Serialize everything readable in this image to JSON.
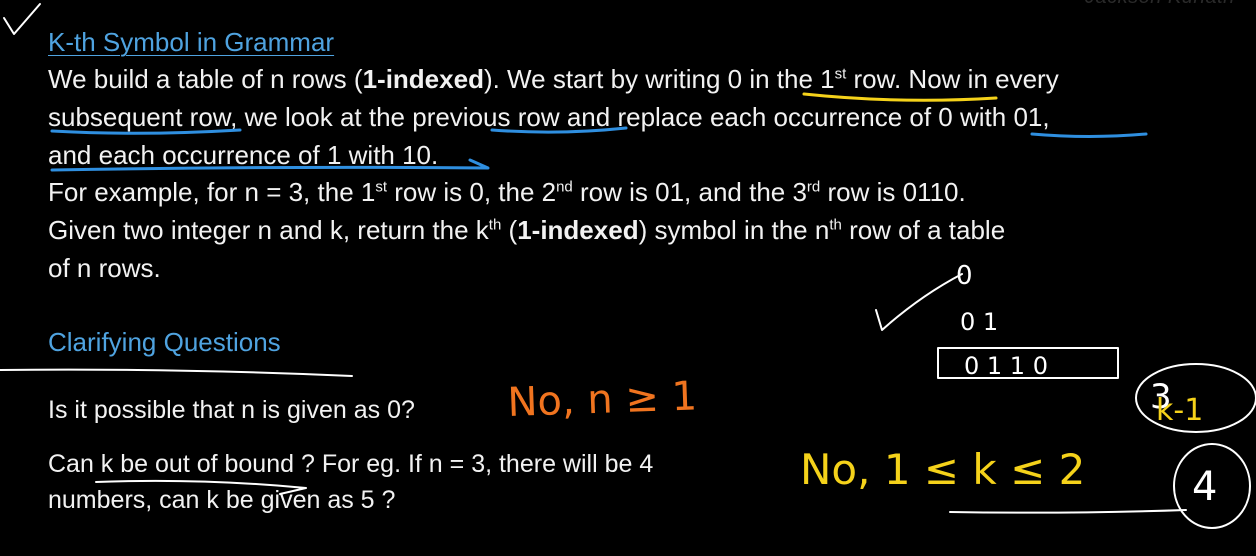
{
  "watermark": "Jackson Kuriath",
  "problem": {
    "title": "K-th Symbol in Grammar",
    "line1_a": "We build a table of n rows (",
    "line1_bold": "1-indexed",
    "line1_b": "). We start by writing 0 in the 1",
    "line1_sup": "st",
    "line1_c": " row. Now in every",
    "line2": "subsequent row, we look at the previous row and replace each occurrence of 0 with 01,",
    "line3": "and each occurrence of 1 with 10.",
    "line4_a": "For example, for n = 3, the 1",
    "line4_sup1": "st",
    "line4_b": " row is 0, the 2",
    "line4_sup2": "nd",
    "line4_c": " row is 01, and the 3",
    "line4_sup3": "rd",
    "line4_d": " row is 0110.",
    "line5_a": "Given two integer n and k, return the k",
    "line5_sup1": "th",
    "line5_b": " (",
    "line5_bold": "1-indexed",
    "line5_c": ") symbol in the n",
    "line5_sup2": "th",
    "line5_d": " row of a table",
    "line6": "of n rows."
  },
  "clarifying": {
    "heading": "Clarifying Questions",
    "q1": "Is it possible that n is given as 0?",
    "q2_line1": "Can k be out of bound ? For eg. If n = 3, there will be 4",
    "q2_line2": "numbers, can k be given as 5 ?"
  },
  "handwritten": {
    "answer1": "No,   n ≥ 1",
    "answer2": "No,   1 ≤ k ≤ 2",
    "row1": "0",
    "row2": "0 1",
    "row3": "0 1 1 0",
    "circled_a": "3",
    "circled_b": "k-1",
    "circled_c": "4"
  },
  "colors": {
    "accent_blue": "#4fa3e0",
    "ink_orange": "#f0741f",
    "ink_yellow": "#f5d21a",
    "ink_white": "#ffffff"
  }
}
